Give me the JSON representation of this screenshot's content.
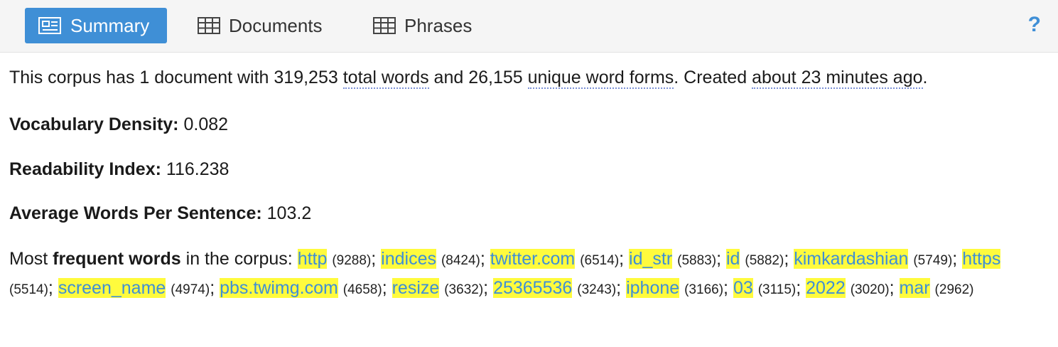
{
  "tabs": [
    {
      "label": "Summary",
      "icon": "newspaper-icon",
      "active": true
    },
    {
      "label": "Documents",
      "icon": "table-icon",
      "active": false
    },
    {
      "label": "Phrases",
      "icon": "table-icon",
      "active": false
    }
  ],
  "help_label": "?",
  "summary": {
    "line1": {
      "prefix": "This corpus has 1 document with 319,253 ",
      "total_words": "total words",
      "mid1": " and 26,155 ",
      "unique": "unique word forms",
      "mid2": ". Created ",
      "created": "about 23 minutes ago",
      "suffix": "."
    },
    "vocab": {
      "label": "Vocabulary Density:",
      "value": "0.082"
    },
    "readability": {
      "label": "Readability Index:",
      "value": "116.238"
    },
    "avg": {
      "label": "Average Words Per Sentence:",
      "value": "103.2"
    },
    "frequent": {
      "prefix": "Most ",
      "bold": "frequent words",
      "suffix": " in the corpus: ",
      "words": [
        {
          "word": "http",
          "count": "(9288)"
        },
        {
          "word": "indices",
          "count": "(8424)"
        },
        {
          "word": "twitter.com",
          "count": "(6514)"
        },
        {
          "word": "id_str",
          "count": "(5883)"
        },
        {
          "word": "id",
          "count": "(5882)"
        },
        {
          "word": "kimkardashian",
          "count": "(5749)"
        },
        {
          "word": "https",
          "count": "(5514)"
        },
        {
          "word": "screen_name",
          "count": "(4974)"
        },
        {
          "word": "pbs.twimg.com",
          "count": "(4658)"
        },
        {
          "word": "resize",
          "count": "(3632)"
        },
        {
          "word": "25365536",
          "count": "(3243)"
        },
        {
          "word": "iphone",
          "count": "(3166)"
        },
        {
          "word": "03",
          "count": "(3115)"
        },
        {
          "word": "2022",
          "count": "(3020)"
        },
        {
          "word": "mar",
          "count": "(2962)"
        }
      ]
    }
  },
  "colors": {
    "accent": "#3f8fd6",
    "highlight": "#fffb3d"
  }
}
